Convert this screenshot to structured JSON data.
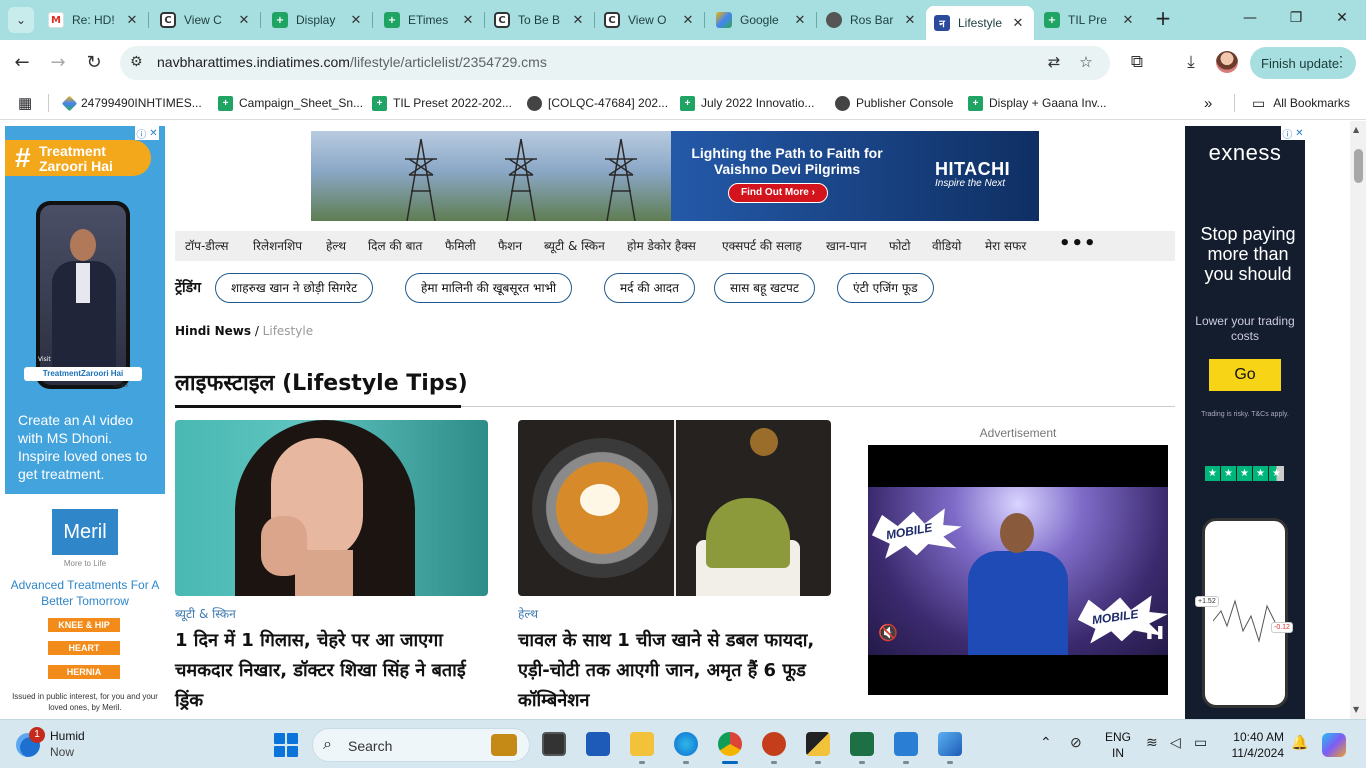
{
  "browser": {
    "tabs": [
      {
        "label": "Re: HD!",
        "favicon": "gmail",
        "color": "#d93025"
      },
      {
        "label": "View C",
        "favicon": "c-logo",
        "color": "#333333"
      },
      {
        "label": "Display",
        "favicon": "sheets",
        "color": "#1fa463"
      },
      {
        "label": "ETimes",
        "favicon": "sheets",
        "color": "#1fa463"
      },
      {
        "label": "To Be B",
        "favicon": "c-logo",
        "color": "#333333"
      },
      {
        "label": "View O",
        "favicon": "c-logo",
        "color": "#333333"
      },
      {
        "label": "Google",
        "favicon": "diamond",
        "color": "#4285f4"
      },
      {
        "label": "Ros Bar",
        "favicon": "globe",
        "color": "#444444"
      },
      {
        "label": "Lifestyle",
        "favicon": "nbt",
        "color": "#2b4a9c",
        "active": true
      },
      {
        "label": "TIL Pre",
        "favicon": "sheets",
        "color": "#1fa463"
      }
    ],
    "url_host": "navbharattimes.indiatimes.com",
    "url_path": "/lifestyle/articlelist/2354729.cms",
    "finish_update": "Finish update",
    "bookmarks": [
      {
        "label": "24799490INHTIMES...",
        "icon": "diamond"
      },
      {
        "label": "Campaign_Sheet_Sn...",
        "icon": "sheet"
      },
      {
        "label": "TIL Preset 2022-202...",
        "icon": "sheet"
      },
      {
        "label": "[COLQC-47684] 202...",
        "icon": "globe"
      },
      {
        "label": "July 2022 Innovatio...",
        "icon": "sheet"
      },
      {
        "label": "Publisher Console",
        "icon": "globe"
      },
      {
        "label": "Display + Gaana Inv...",
        "icon": "sheet"
      }
    ],
    "all_bookmarks": "All Bookmarks"
  },
  "ads": {
    "left": {
      "hash": "#",
      "line1": "Treatment",
      "line2": "Zaroori Hai",
      "phone_visit": "Visit",
      "phone_label": "TreatmentZaroori Hai",
      "phone_com": ".com",
      "text": "Create an AI video with MS Dhoni. Inspire loved ones to get treatment."
    },
    "meril": {
      "logo": "Meril",
      "tagline": "More to Life",
      "headline": "Advanced Treatments For A Better Tomorrow",
      "pills": [
        "KNEE & HIP",
        "HEART",
        "HERNIA"
      ],
      "footer": "Issued in public interest, for you and your loved ones, by Meril."
    },
    "top": {
      "headline": "Lighting the Path to Faith for Vaishno Devi Pilgrims",
      "cta": "Find Out More ›",
      "brand": "HITACHI",
      "tagline": "Inspire the Next"
    },
    "right": {
      "brand": "exness",
      "headline": "Stop paying more than you should",
      "sub": "Lower your trading costs",
      "cta": "Go",
      "risk": "Trading is risky. T&Cs apply.",
      "tag1": "+1.52",
      "tag2": "-0.12"
    },
    "video_label": "Advertisement",
    "video_burst1": "MOBILE",
    "video_burst2": "MOBILE"
  },
  "nav": {
    "items": [
      "टॉप-डील्स",
      "रिलेशनशिप",
      "हेल्थ",
      "दिल की बात",
      "फैमिली",
      "फैशन",
      "ब्यूटी & स्किन",
      "होम डेकोर हैक्स",
      "एक्सपर्ट की सलाह",
      "खान-पान",
      "फोटो",
      "वीडियो",
      "मेरा सफर"
    ],
    "more": "•••"
  },
  "trending": {
    "label": "ट्रेंडिंग",
    "chips": [
      "शाहरुख खान ने छोड़ी सिगरेट",
      "हेमा मालिनी की खूबसूरत भाभी",
      "मर्द की आदत",
      "सास बहू खटपट",
      "एंटी एजिंग फूड"
    ]
  },
  "breadcrumb": {
    "home": "Hindi News",
    "sep": " / ",
    "current": "Lifestyle"
  },
  "page_title": "लाइफस्टाइल (Lifestyle Tips)",
  "articles": [
    {
      "category": "ब्यूटी & स्किन",
      "headline": "1 दिन में 1 गिलास, चेहरे पर आ जाएगा चमकदार निखार, डॉक्टर शिखा सिंह ने बताई ड्रिंक"
    },
    {
      "category": "हेल्थ",
      "headline": "चावल के साथ 1 चीज खाने से डबल फायदा, एड़ी-चोटी तक आएगी जान, अमृत हैं 6 फूड कॉम्बिनेशन"
    }
  ],
  "taskbar": {
    "weather_title": "Humid",
    "weather_sub": "Now",
    "notification_count": "1",
    "search_placeholder": "Search",
    "lang1": "ENG",
    "lang2": "IN",
    "time": "10:40 AM",
    "date": "11/4/2024"
  }
}
